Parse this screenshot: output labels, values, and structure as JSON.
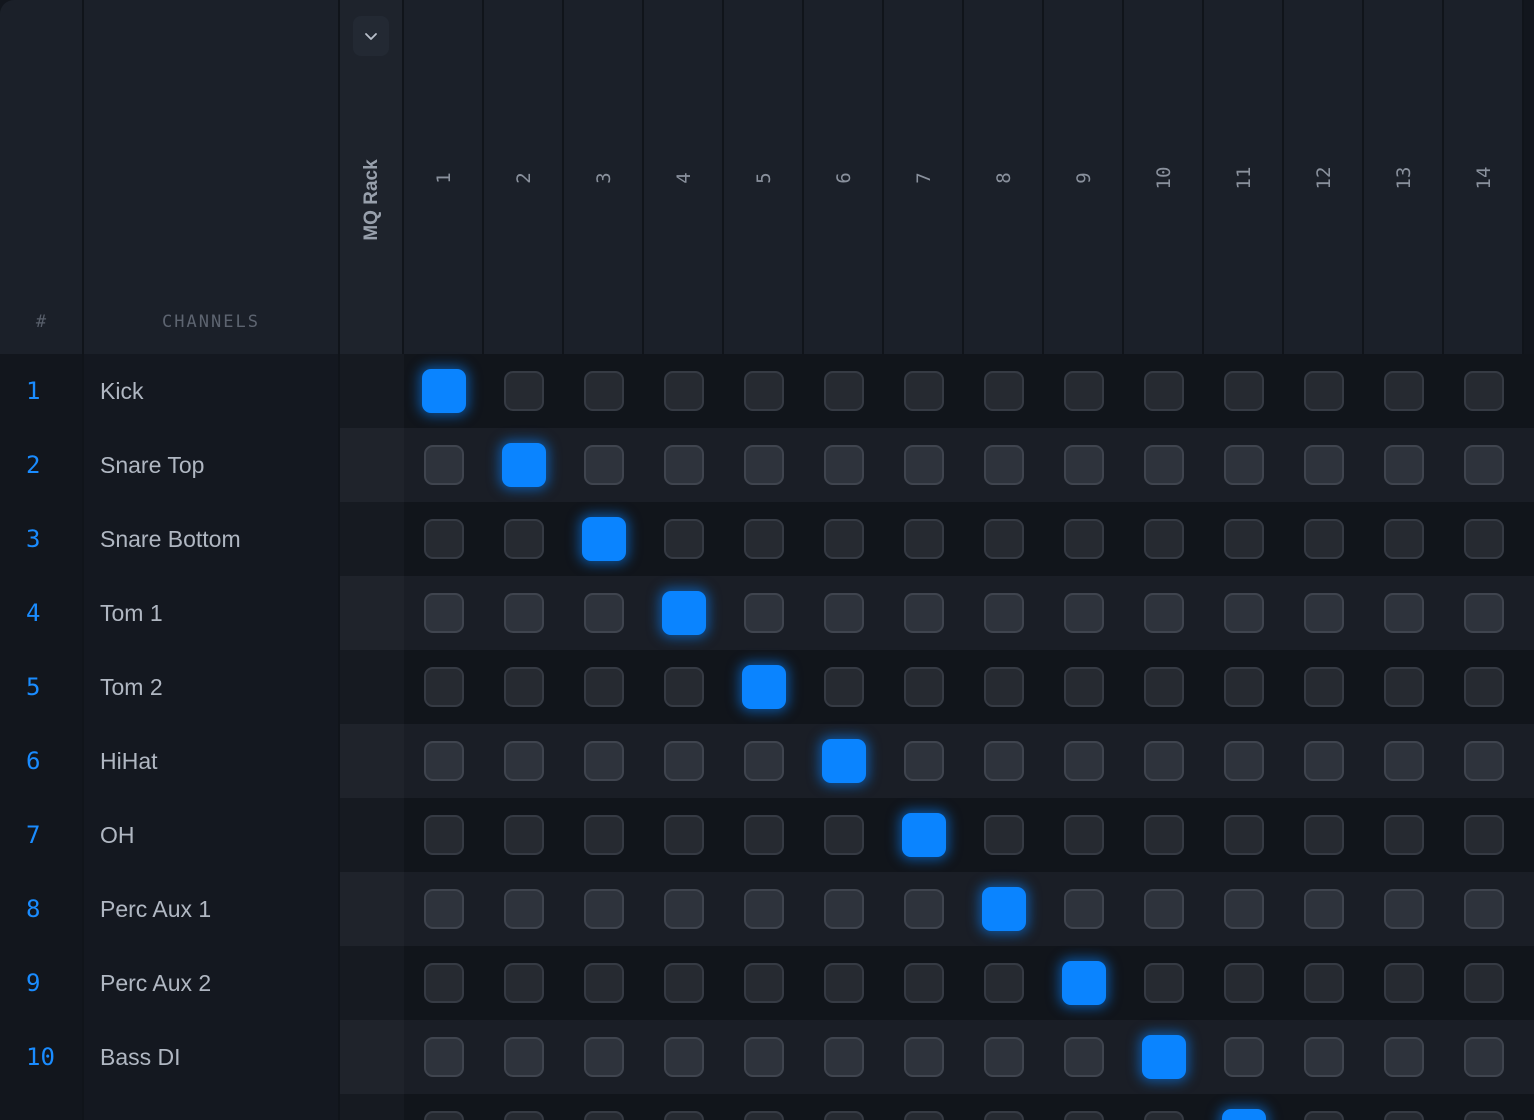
{
  "header": {
    "number_label": "#",
    "channels_label": "CHANNELS",
    "rack_label": "MQ Rack",
    "rack_dropdown_icon": "chevron-down-icon",
    "columns": [
      "1",
      "2",
      "3",
      "4",
      "5",
      "6",
      "7",
      "8",
      "9",
      "10",
      "11",
      "12",
      "13",
      "14"
    ]
  },
  "colors": {
    "accent": "#0a84ff",
    "background": "#12161d",
    "header_bg": "#1b2029",
    "pad_off": "#262a31"
  },
  "rows": [
    {
      "num": "1",
      "name": "Kick",
      "active": 1
    },
    {
      "num": "2",
      "name": "Snare Top",
      "active": 2
    },
    {
      "num": "3",
      "name": "Snare Bottom",
      "active": 3
    },
    {
      "num": "4",
      "name": "Tom 1",
      "active": 4
    },
    {
      "num": "5",
      "name": "Tom 2",
      "active": 5
    },
    {
      "num": "6",
      "name": "HiHat",
      "active": 6
    },
    {
      "num": "7",
      "name": "OH",
      "active": 7
    },
    {
      "num": "8",
      "name": "Perc Aux 1",
      "active": 8
    },
    {
      "num": "9",
      "name": "Perc Aux 2",
      "active": 9
    },
    {
      "num": "10",
      "name": "Bass DI",
      "active": 10
    },
    {
      "num": "",
      "name": "",
      "active": 11
    }
  ]
}
